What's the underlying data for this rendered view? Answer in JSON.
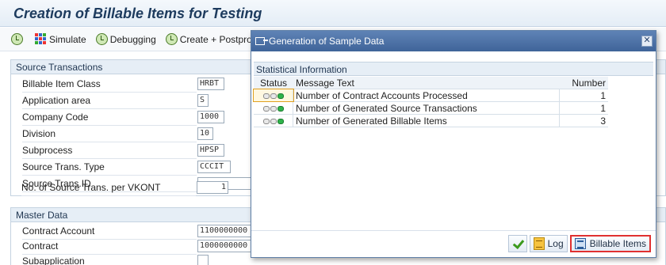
{
  "page_title": "Creation of Billable Items for Testing",
  "toolbar": {
    "items": [
      {
        "label": ""
      },
      {
        "label": "Simulate"
      },
      {
        "label": "Debugging"
      },
      {
        "label": "Create + Postproces"
      }
    ]
  },
  "source_transactions": {
    "header": "Source Transactions",
    "fields": [
      {
        "label": "Billable Item Class",
        "value": "HRBT"
      },
      {
        "label": "Application area",
        "value": "S"
      },
      {
        "label": "Company Code",
        "value": "1000"
      },
      {
        "label": "Division",
        "value": "10"
      },
      {
        "label": "Subprocess",
        "value": "HPSP"
      },
      {
        "label": "Source Trans. Type",
        "value": "CCCIT"
      },
      {
        "label": "Source Trans.ID",
        "value": ""
      },
      {
        "label": "No. of Source Trans. per VKONT",
        "value": "1"
      }
    ]
  },
  "master_data": {
    "header": "Master Data",
    "fields": [
      {
        "label": "Contract Account",
        "value": "1100000000"
      },
      {
        "label": "Contract",
        "value": "1000000000"
      },
      {
        "label": "Subapplication",
        "value": ""
      }
    ]
  },
  "dialog": {
    "title": "Generation of Sample Data",
    "section_title": "Statistical Information",
    "columns": {
      "status": "Status",
      "message": "Message Text",
      "number": "Number"
    },
    "rows": [
      {
        "message": "Number of Contract Accounts Processed",
        "number": "1",
        "status": "green"
      },
      {
        "message": "Number of Generated Source Transactions",
        "number": "1",
        "status": "green"
      },
      {
        "message": "Number of Generated Billable Items",
        "number": "3",
        "status": "green"
      }
    ],
    "footer": {
      "log_label": "Log",
      "billable_items_label": "Billable Items"
    }
  }
}
